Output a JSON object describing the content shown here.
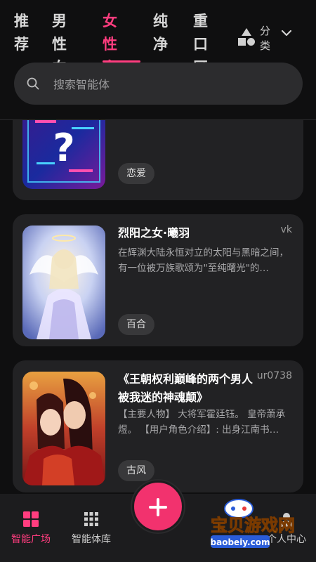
{
  "tabs": [
    {
      "label": "推荐",
      "active": false
    },
    {
      "label": "男性向",
      "active": false
    },
    {
      "label": "女性向",
      "active": true
    },
    {
      "label": "纯净",
      "active": false
    },
    {
      "label": "重口区",
      "active": false
    }
  ],
  "category": {
    "label": "分类",
    "icon": "shapes-icon"
  },
  "search": {
    "placeholder": "搜索智能体",
    "icon": "search-icon"
  },
  "cards": [
    {
      "title": "",
      "author": "",
      "desc": "",
      "tag": "恋爱"
    },
    {
      "title": "烈阳之女·曦羽",
      "author": "vk",
      "desc": "在辉渊大陆永恒对立的太阳与黑暗之间，有一位被万族歌颂为\"至纯曙光\"的…",
      "tag": "百合"
    },
    {
      "title": "《王朝权利巅峰的两个男人被我迷的神魂颠》",
      "author": "ur0738",
      "desc": "【主要人物】 大将军霍廷钰。 皇帝萧承煜。 【用户角色介绍】: 出身江南书…",
      "tag": "古风"
    }
  ],
  "bottom_nav": {
    "items": [
      {
        "label": "智能广场",
        "icon": "grid-four-icon",
        "active": true
      },
      {
        "label": "智能体库",
        "icon": "dots-grid-icon",
        "active": false
      },
      {
        "label": "个人中心",
        "icon": "person-icon",
        "active": false
      }
    ],
    "fab_icon": "plus-icon"
  },
  "watermark": {
    "title": "宝贝游戏网",
    "url": "baobeiy.com"
  },
  "colors": {
    "accent": "#ff3d7f",
    "background": "#0f0f10",
    "card": "#222224"
  }
}
